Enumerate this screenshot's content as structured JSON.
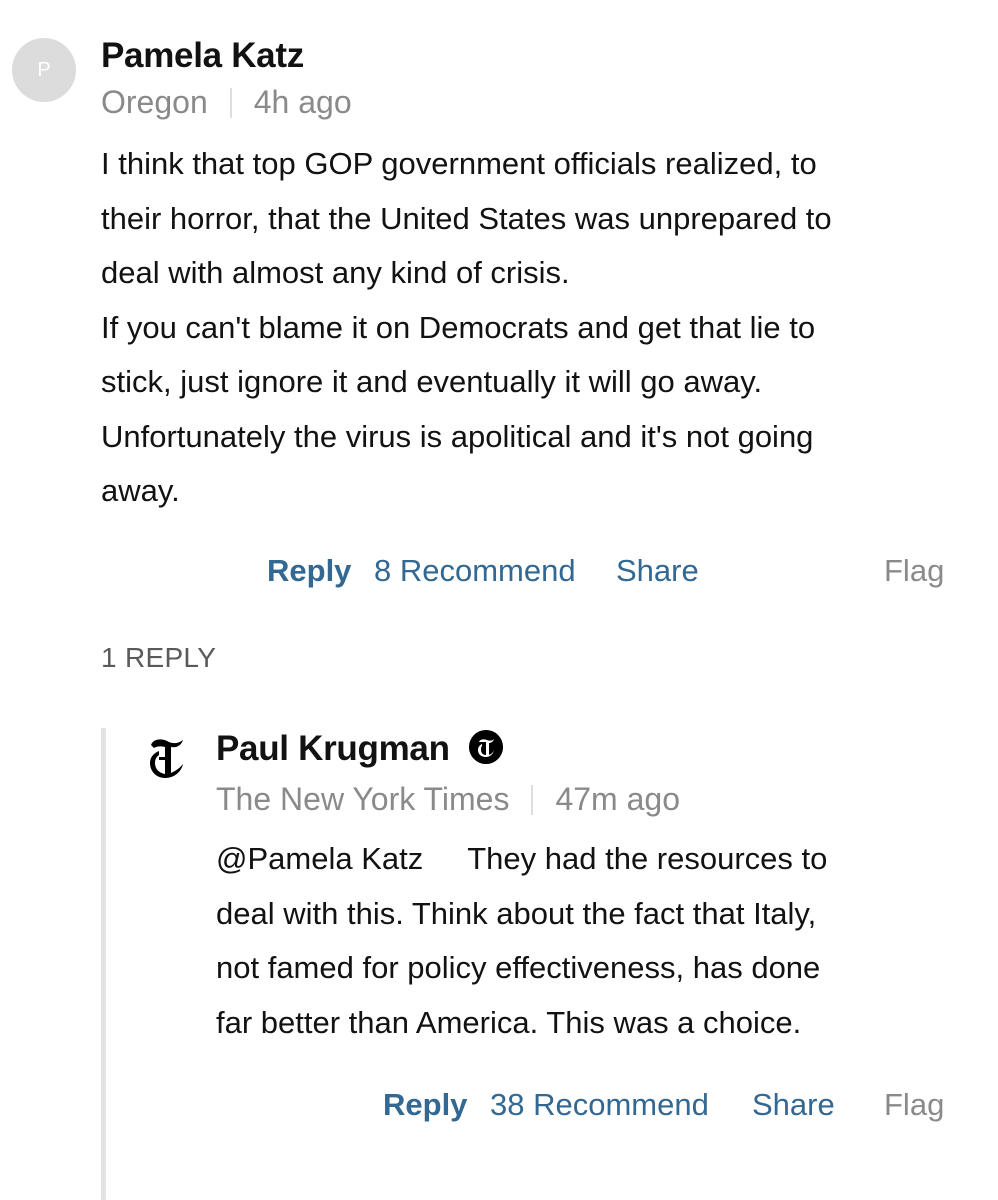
{
  "comment": {
    "avatar_initial": "P",
    "author": "Pamela Katz",
    "location": "Oregon",
    "time": "4h ago",
    "body_lines": [
      "I think that top GOP government officials realized, to",
      "their horror, that the United States was unprepared to",
      "deal with almost any kind of crisis.",
      "If you can't blame it on Democrats and get that lie to",
      "stick, just ignore it and eventually it will go away.",
      "Unfortunately the virus is apolitical and it's not going",
      "away."
    ],
    "actions": {
      "reply": "Reply",
      "recommend": "8 Recommend",
      "share": "Share",
      "flag": "Flag"
    }
  },
  "replies_label": "1 REPLY",
  "reply": {
    "logo_icon": "nyt-t-logo-icon",
    "verified_icon": "nyt-badge-icon",
    "author": "Paul Krugman",
    "affiliation": "The New York Times",
    "time": "47m ago",
    "mention": "@Pamela Katz",
    "body_lines": [
      "They had the resources to",
      "deal with this. Think about the fact that Italy,",
      "not famed for policy effectiveness, has done",
      "far better than America. This was a choice."
    ],
    "actions": {
      "reply": "Reply",
      "recommend": "38 Recommend",
      "share": "Share",
      "flag": "Flag"
    }
  },
  "colors": {
    "link_blue": "#326891",
    "meta_gray": "#8a8a8a",
    "text_dark": "#121212",
    "thread_line": "#e2e2e2",
    "avatar_bg": "#dcdcdc"
  }
}
